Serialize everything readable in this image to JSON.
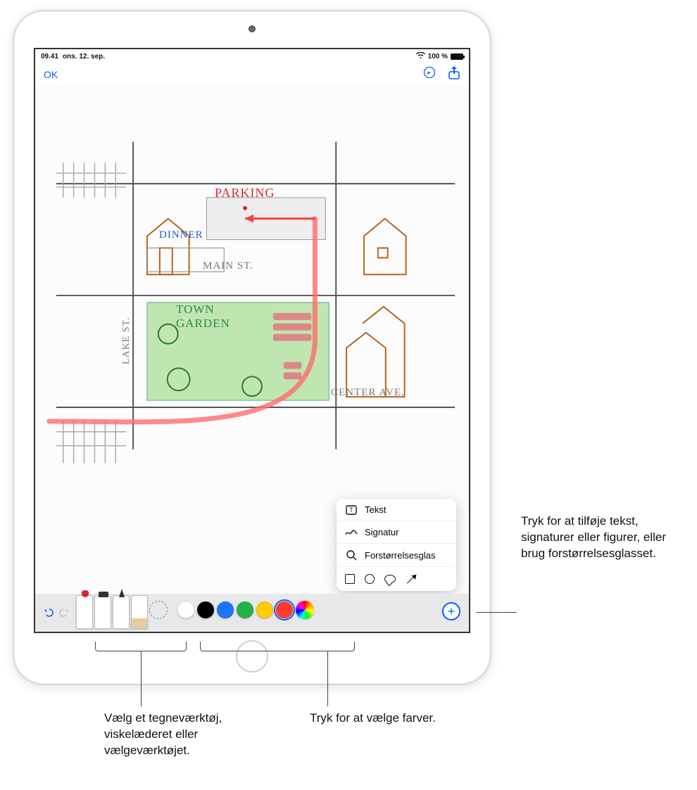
{
  "statusbar": {
    "time": "09.41",
    "date": "ons. 12. sep.",
    "battery": "100 %"
  },
  "navbar": {
    "ok_label": "OK"
  },
  "sketch": {
    "parking": "PARKING",
    "dinner": "DINNER",
    "main_st": "MAIN ST.",
    "town_garden_1": "TOWN",
    "town_garden_2": "GARDEN",
    "lake_st": "LAKE ST.",
    "center_ave": "CENTER AVE."
  },
  "popup": {
    "text": "Tekst",
    "signature": "Signatur",
    "magnifier": "Forstørrelsesglas"
  },
  "swatches": [
    "#ffffff",
    "#000000",
    "#1e73ff",
    "#22b24c",
    "#ffcc00",
    "#ff3b30"
  ],
  "selected_swatch": 5,
  "callouts": {
    "add": "Tryk for at tilføje tekst, signaturer eller figurer, eller brug forstørrelsesglasset.",
    "tools": "Vælg et tegneværktøj, viskelæderet eller vælgeværktøjet.",
    "colors": "Tryk for at vælge farver."
  }
}
